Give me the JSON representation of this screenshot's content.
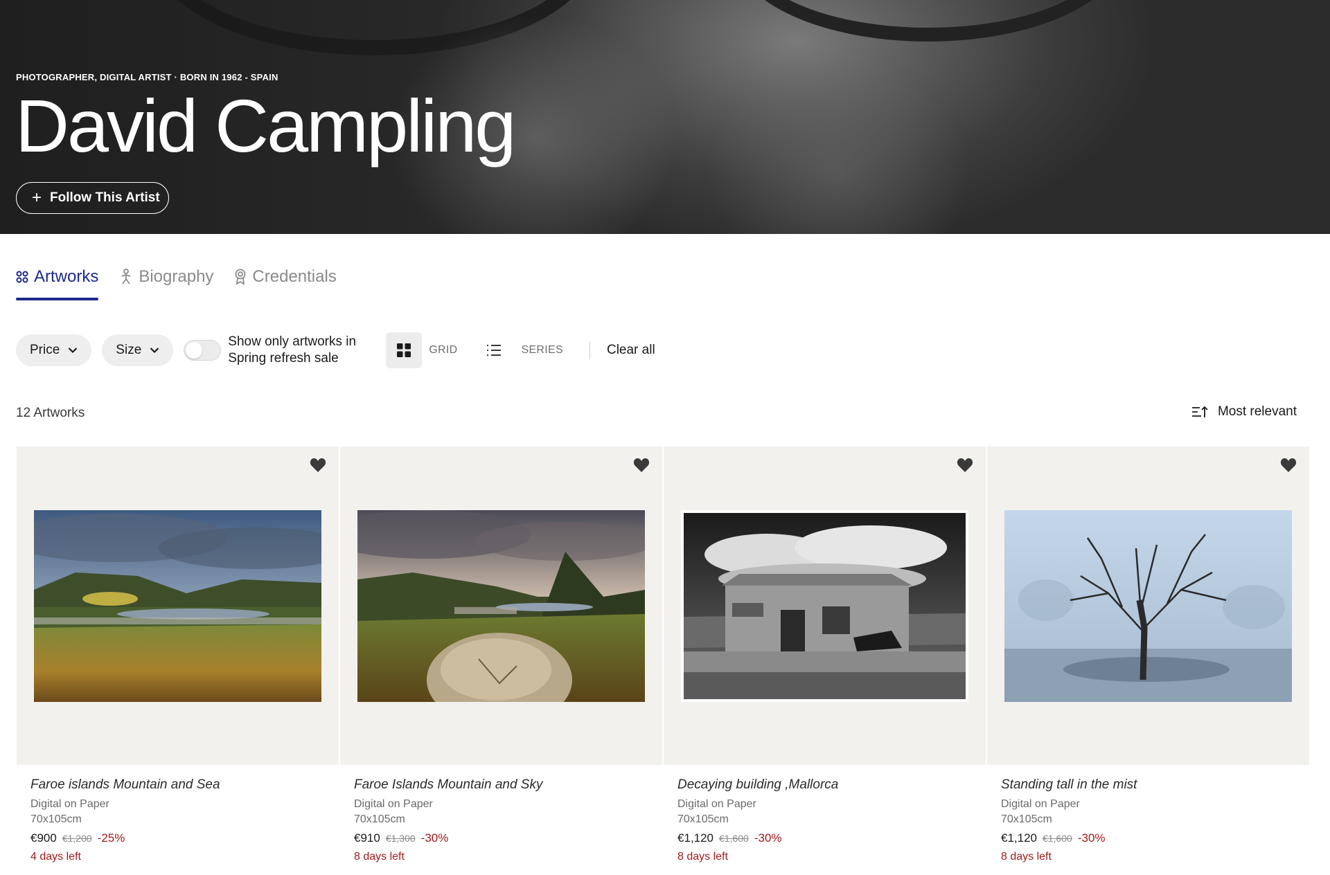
{
  "hero": {
    "subtitle": "PHOTOGRAPHER, DIGITAL ARTIST · BORN IN 1962 - SPAIN",
    "artist_name": "David Campling",
    "follow_label": "Follow This Artist"
  },
  "tabs": [
    {
      "label": "Artworks",
      "icon": "grid-dots-icon",
      "active": true
    },
    {
      "label": "Biography",
      "icon": "person-icon",
      "active": false
    },
    {
      "label": "Credentials",
      "icon": "award-icon",
      "active": false
    }
  ],
  "filters": {
    "price_label": "Price",
    "size_label": "Size",
    "toggle_label": "Show only artworks in Spring refresh sale",
    "toggle_on": false,
    "grid_label": "GRID",
    "series_label": "SERIES",
    "clear_all_label": "Clear all"
  },
  "results": {
    "count_label": "12 Artworks",
    "sort_label": "Most relevant"
  },
  "artworks": [
    {
      "title": "Faroe islands Mountain and Sea",
      "medium": "Digital on Paper",
      "size": "70x105cm",
      "price": "€900",
      "old_price": "€1,200",
      "discount": "-25%",
      "days_left": "4 days left"
    },
    {
      "title": "Faroe Islands Mountain and Sky",
      "medium": "Digital on Paper",
      "size": "70x105cm",
      "price": "€910",
      "old_price": "€1,300",
      "discount": "-30%",
      "days_left": "8 days left"
    },
    {
      "title": "Decaying building ,Mallorca",
      "medium": "Digital on Paper",
      "size": "70x105cm",
      "price": "€1,120",
      "old_price": "€1,600",
      "discount": "-30%",
      "days_left": "8 days left"
    },
    {
      "title": "Standing tall in the mist",
      "medium": "Digital on Paper",
      "size": "70x105cm",
      "price": "€1,120",
      "old_price": "€1,600",
      "discount": "-30%",
      "days_left": "8 days left"
    }
  ],
  "colors": {
    "accent": "#1e2a8c",
    "sale_red": "#a11a1a",
    "card_bg": "#f3f1ed"
  }
}
